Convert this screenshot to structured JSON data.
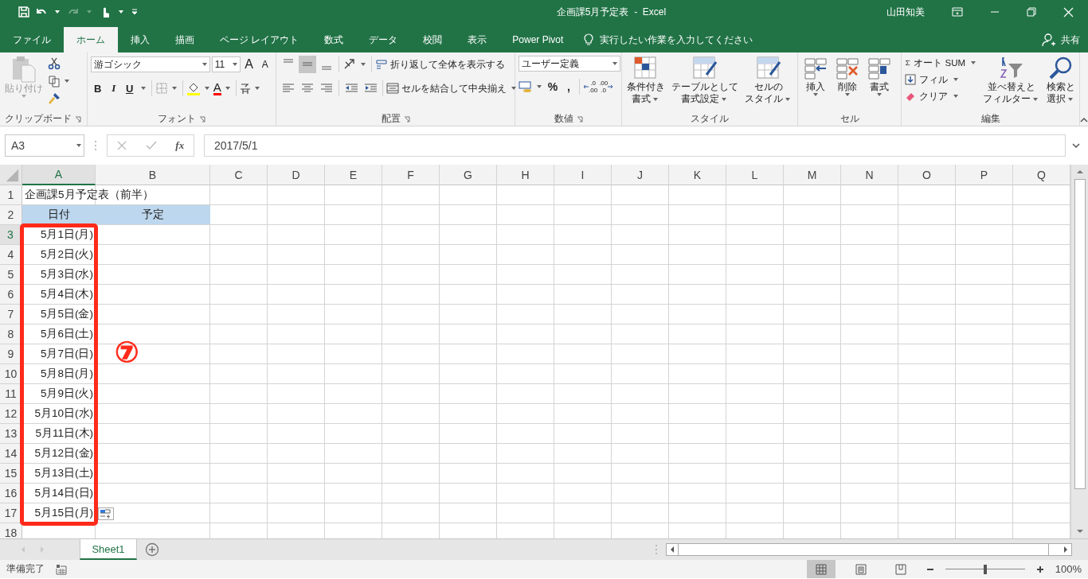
{
  "title_bar": {
    "title": "企画課5月予定表  -  Excel",
    "user": "山田知美"
  },
  "menu_tabs": [
    {
      "label": "ファイル",
      "selected": false
    },
    {
      "label": "ホーム",
      "selected": true
    },
    {
      "label": "挿入",
      "selected": false
    },
    {
      "label": "描画",
      "selected": false
    },
    {
      "label": "ページ レイアウト",
      "selected": false
    },
    {
      "label": "数式",
      "selected": false
    },
    {
      "label": "データ",
      "selected": false
    },
    {
      "label": "校閲",
      "selected": false
    },
    {
      "label": "表示",
      "selected": false
    },
    {
      "label": "Power Pivot",
      "selected": false
    }
  ],
  "tell_me": {
    "placeholder": "実行したい作業を入力してください"
  },
  "share": "共有",
  "ribbon": {
    "clipboard": {
      "label": "クリップボード",
      "paste": "貼り付け"
    },
    "font": {
      "label": "フォント",
      "name": "游ゴシック",
      "size": "11",
      "grow": "A",
      "shrink": "A",
      "bold": "B",
      "italic": "I",
      "underline": "U",
      "font_color_glyph": "A"
    },
    "alignment": {
      "label": "配置",
      "valign": [
        {
          "selected": false
        },
        {
          "selected": true
        },
        {
          "selected": false
        }
      ],
      "wrap": "折り返して全体を表示する",
      "merge": "セルを結合して中央揃え"
    },
    "number": {
      "label": "数値",
      "format": "ユーザー定義",
      "percent": "%",
      "comma": ",",
      "increase": [
        ".0",
        ".00"
      ],
      "decrease": [
        ".00",
        ".0"
      ]
    },
    "styles": {
      "label": "スタイル",
      "buttons": [
        [
          "条件付き",
          "書式"
        ],
        [
          "テーブルとして",
          "書式設定"
        ],
        [
          "セルの",
          "スタイル"
        ]
      ]
    },
    "cells": {
      "label": "セル",
      "buttons": [
        "挿入",
        "削除",
        "書式"
      ]
    },
    "editing": {
      "label": "編集",
      "autosum": "オート SUM",
      "fill": "フィル",
      "clear": "クリア",
      "sort": [
        "並べ替えと",
        "フィルター"
      ],
      "find": [
        "検索と",
        "選択"
      ]
    }
  },
  "formula_bar": {
    "name_box": "A3",
    "fx": "fx",
    "value": "2017/5/1"
  },
  "columns": [
    {
      "label": "A",
      "selected": true
    },
    {
      "label": "B",
      "selected": false
    },
    {
      "label": "C",
      "selected": false
    },
    {
      "label": "D",
      "selected": false
    },
    {
      "label": "E",
      "selected": false
    },
    {
      "label": "F",
      "selected": false
    },
    {
      "label": "G",
      "selected": false
    },
    {
      "label": "H",
      "selected": false
    },
    {
      "label": "I",
      "selected": false
    },
    {
      "label": "J",
      "selected": false
    },
    {
      "label": "K",
      "selected": false
    },
    {
      "label": "L",
      "selected": false
    },
    {
      "label": "M",
      "selected": false
    },
    {
      "label": "N",
      "selected": false
    },
    {
      "label": "O",
      "selected": false
    },
    {
      "label": "P",
      "selected": false
    },
    {
      "label": "Q",
      "selected": false
    }
  ],
  "rows": [
    {
      "number": "1",
      "kind": "title",
      "selected": false,
      "cells": [
        "企画課5月予定表（前半）"
      ]
    },
    {
      "number": "2",
      "kind": "header",
      "selected": false,
      "cells": [
        "日付",
        "予定"
      ]
    },
    {
      "number": "3",
      "kind": "date",
      "selected": true,
      "cells": [
        "5月1日(月)"
      ]
    },
    {
      "number": "4",
      "kind": "date",
      "selected": false,
      "cells": [
        "5月2日(火)"
      ]
    },
    {
      "number": "5",
      "kind": "date",
      "selected": false,
      "cells": [
        "5月3日(水)"
      ]
    },
    {
      "number": "6",
      "kind": "date",
      "selected": false,
      "cells": [
        "5月4日(木)"
      ]
    },
    {
      "number": "7",
      "kind": "date",
      "selected": false,
      "cells": [
        "5月5日(金)"
      ]
    },
    {
      "number": "8",
      "kind": "date",
      "selected": false,
      "cells": [
        "5月6日(土)"
      ]
    },
    {
      "number": "9",
      "kind": "date",
      "selected": false,
      "cells": [
        "5月7日(日)"
      ]
    },
    {
      "number": "10",
      "kind": "date",
      "selected": false,
      "cells": [
        "5月8日(月)"
      ]
    },
    {
      "number": "11",
      "kind": "date",
      "selected": false,
      "cells": [
        "5月9日(火)"
      ]
    },
    {
      "number": "12",
      "kind": "date",
      "selected": false,
      "cells": [
        "5月10日(水)"
      ]
    },
    {
      "number": "13",
      "kind": "date",
      "selected": false,
      "cells": [
        "5月11日(木)"
      ]
    },
    {
      "number": "14",
      "kind": "date",
      "selected": false,
      "cells": [
        "5月12日(金)"
      ]
    },
    {
      "number": "15",
      "kind": "date",
      "selected": false,
      "cells": [
        "5月13日(土)"
      ]
    },
    {
      "number": "16",
      "kind": "date",
      "selected": false,
      "cells": [
        "5月14日(日)"
      ]
    },
    {
      "number": "17",
      "kind": "date",
      "selected": false,
      "cells": [
        "5月15日(月)"
      ]
    },
    {
      "number": "18",
      "kind": "empty",
      "selected": false
    }
  ],
  "annotation": {
    "marker": "⑦"
  },
  "sheet_tabs": [
    {
      "label": "Sheet1",
      "selected": true
    }
  ],
  "status_bar": {
    "status": "準備完了",
    "views": [
      {
        "selected": true
      },
      {
        "selected": false
      },
      {
        "selected": false
      }
    ],
    "zoom": {
      "level": 0.5,
      "reading": "100%"
    }
  }
}
